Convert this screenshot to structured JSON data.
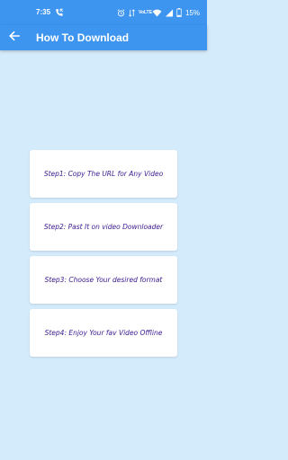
{
  "status_bar": {
    "time": "7:35",
    "network_label": "VoLTE",
    "battery_percent": "15%",
    "icons": [
      "phone-call-icon",
      "alarm-icon",
      "data-icon",
      "wifi-icon",
      "signal-icon",
      "battery-icon"
    ]
  },
  "app_bar": {
    "title": "How To Download",
    "back_icon": "arrow-left-icon",
    "color": "#3d95f0"
  },
  "steps": [
    {
      "text": "Step1: Copy The URL for Any Video"
    },
    {
      "text": "Step2: Past It on video Downloader"
    },
    {
      "text": "Step3: Choose Your desired format"
    },
    {
      "text": "Step4: Enjoy Your fav Video Offline"
    }
  ],
  "colors": {
    "background": "#d4ebfb",
    "card": "#ffffff",
    "step_text": "#3a1a8f"
  }
}
